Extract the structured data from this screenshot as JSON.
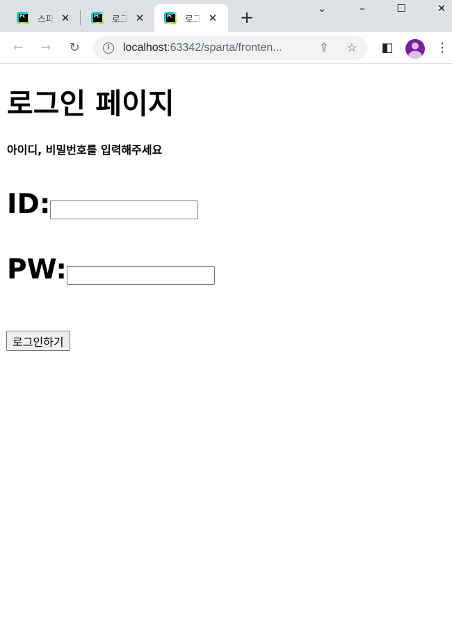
{
  "browser": {
    "tabs": [
      {
        "title": "스파르타",
        "active": false
      },
      {
        "title": "로그인",
        "active": false
      },
      {
        "title": "로그인",
        "active": true
      }
    ],
    "new_tab_icon": "plus-icon",
    "url_host": "localhost",
    "url_path": ":63342/sparta/fronten..."
  },
  "page": {
    "title": "로그인 페이지",
    "subtitle": "아이디, 비밀번호를 입력해주세요",
    "id_label": "ID:",
    "id_value": "",
    "pw_label": "PW:",
    "pw_value": "",
    "login_button": "로그인하기"
  },
  "colors": {
    "tabstrip_bg": "#dee1e6",
    "omnibox_bg": "#f1f3f4",
    "avatar": "#7b1fa2"
  }
}
